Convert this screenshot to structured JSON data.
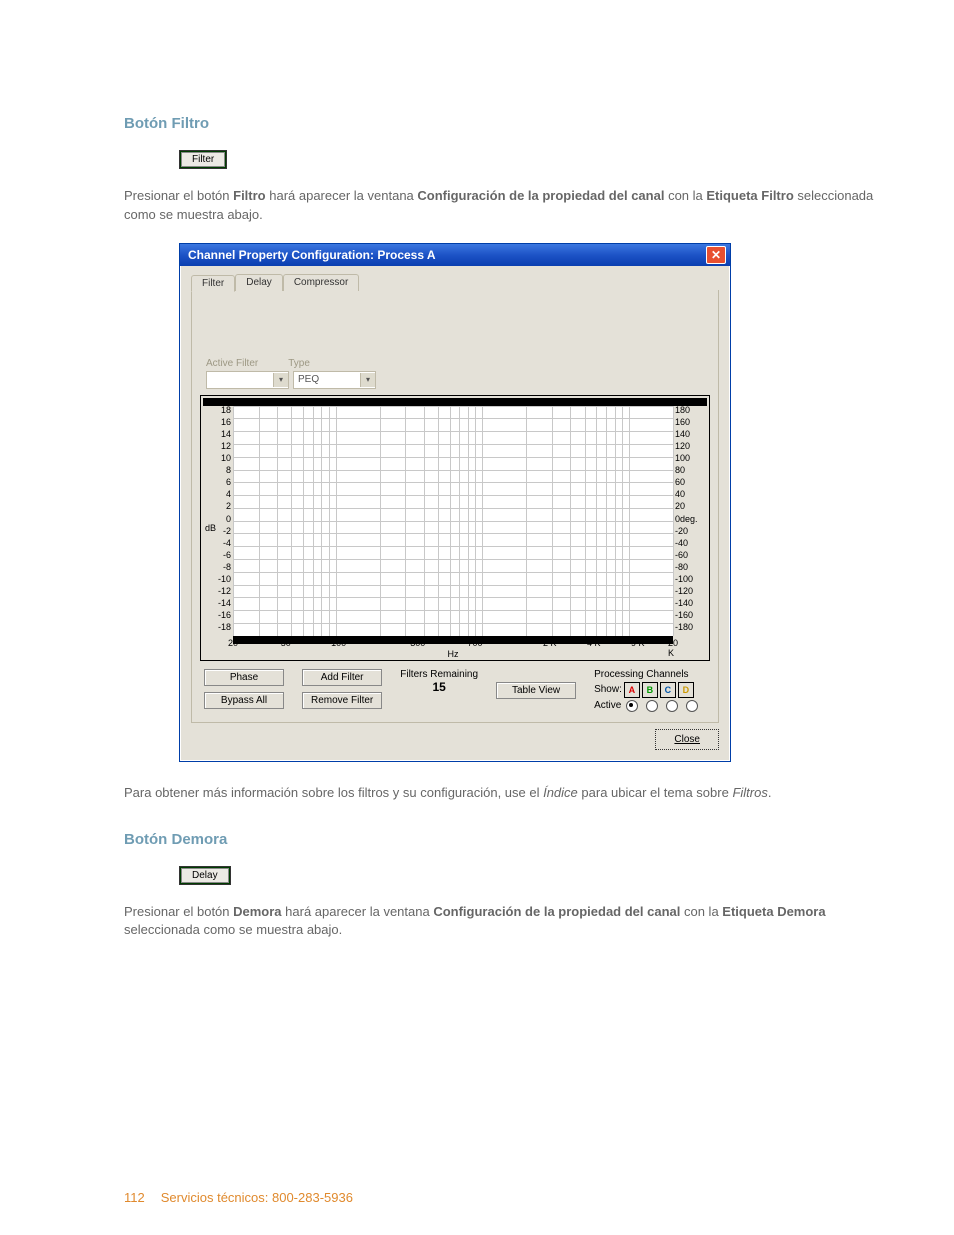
{
  "section1": {
    "heading": "Botón Filtro",
    "small_button_label": "Filter",
    "para_pre": "Presionar el botón ",
    "para_b1": "Filtro",
    "para_mid1": " hará aparecer la ventana ",
    "para_b2": "Configuración de la propiedad del canal",
    "para_mid2": " con la ",
    "para_b3": "Etiqueta Filtro",
    "para_post": " seleccionada como se muestra abajo."
  },
  "dialog": {
    "title": "Channel Property Configuration: Process A",
    "tabs": {
      "filter": "Filter",
      "delay": "Delay",
      "compressor": "Compressor"
    },
    "labels": {
      "active_filter": "Active Filter",
      "type": "Type"
    },
    "dropdowns": {
      "active_filter_value": "",
      "type_value": "PEQ"
    },
    "chart": {
      "y_left": [
        "18",
        "16",
        "14",
        "12",
        "10",
        "8",
        "6",
        "4",
        "2",
        "0",
        "-2",
        "-4",
        "-6",
        "-8",
        "-10",
        "-12",
        "-14",
        "-16",
        "-18"
      ],
      "y_left_label": "dB",
      "y_right": [
        "180",
        "160",
        "140",
        "120",
        "100",
        "80",
        "60",
        "40",
        "20",
        "0deg.",
        "-20",
        "-40",
        "-60",
        "-80",
        "-100",
        "-120",
        "-140",
        "-160",
        "-180"
      ],
      "x_ticks": [
        {
          "pos": 0,
          "label": "20"
        },
        {
          "pos": 12,
          "label": "50"
        },
        {
          "pos": 24,
          "label": "100"
        },
        {
          "pos": 42,
          "label": "300"
        },
        {
          "pos": 55,
          "label": "700"
        },
        {
          "pos": 72,
          "label": "2 K"
        },
        {
          "pos": 82,
          "label": "4 K"
        },
        {
          "pos": 92,
          "label": "9 K"
        },
        {
          "pos": 100,
          "label": "20 K"
        }
      ],
      "x_label": "Hz"
    },
    "buttons": {
      "phase": "Phase",
      "bypass_all": "Bypass All",
      "add_filter": "Add Filter",
      "remove_filter": "Remove Filter",
      "table_view": "Table View"
    },
    "filters_remaining_label": "Filters Remaining",
    "filters_remaining_value": "15",
    "processing_channels": {
      "title": "Processing Channels",
      "show_label": "Show:",
      "active_label": "Active",
      "channels": [
        "A",
        "B",
        "C",
        "D"
      ]
    },
    "close_label": "Close"
  },
  "after_dialog": {
    "pre": "Para obtener más información sobre los filtros y su configuración, use el ",
    "i1": "Índice",
    "mid": " para ubicar el tema sobre ",
    "i2": "Filtros",
    "post": "."
  },
  "section2": {
    "heading": "Botón Demora",
    "small_button_label": "Delay",
    "para_pre": "Presionar el botón ",
    "para_b1": "Demora",
    "para_mid1": " hará aparecer la ventana ",
    "para_b2": "Configuración de la propiedad del canal",
    "para_mid2": " con la ",
    "para_b3": "Etiqueta Demora",
    "para_post": " seleccionada como se muestra abajo."
  },
  "footer": {
    "page": "112",
    "text": "Servicios técnicos: 800-283-5936"
  },
  "chart_data": {
    "type": "line",
    "title": "",
    "xlabel": "Hz",
    "ylabel_left": "dB",
    "ylabel_right": "deg.",
    "x_scale": "log",
    "x_range": [
      20,
      20000
    ],
    "y_left_range": [
      -18,
      18
    ],
    "y_right_range": [
      -180,
      180
    ],
    "x_ticks": [
      20,
      50,
      100,
      300,
      700,
      2000,
      4000,
      9000,
      20000
    ],
    "y_left_ticks": [
      18,
      16,
      14,
      12,
      10,
      8,
      6,
      4,
      2,
      0,
      -2,
      -4,
      -6,
      -8,
      -10,
      -12,
      -14,
      -16,
      -18
    ],
    "y_right_ticks": [
      180,
      160,
      140,
      120,
      100,
      80,
      60,
      40,
      20,
      0,
      -20,
      -40,
      -60,
      -80,
      -100,
      -120,
      -140,
      -160,
      -180
    ],
    "series": []
  }
}
